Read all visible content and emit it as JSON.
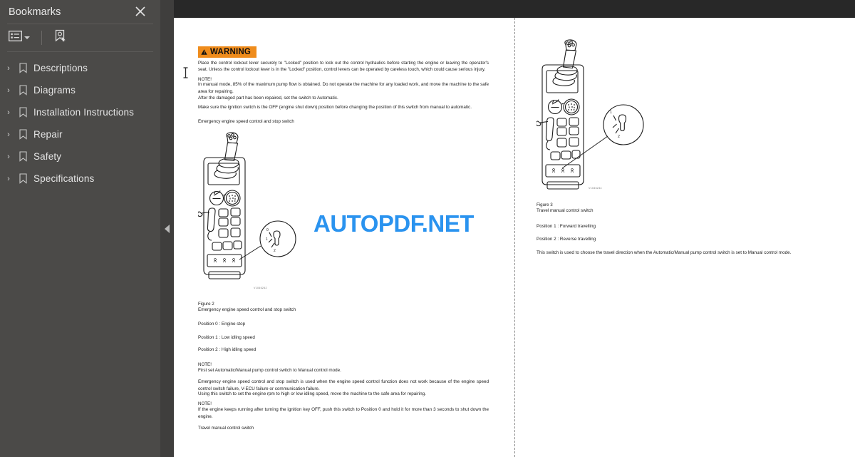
{
  "sidebar": {
    "title": "Bookmarks",
    "close_icon": "close-icon",
    "toolbar": {
      "options_icon": "list-options-icon",
      "options_caret": "chevron-down-icon",
      "new_bookmark_icon": "new-bookmark-icon"
    },
    "items": [
      {
        "label": "Descriptions",
        "expand_arrow": "›",
        "icon": "bookmark-icon"
      },
      {
        "label": "Diagrams",
        "expand_arrow": "›",
        "icon": "bookmark-icon"
      },
      {
        "label": "Installation Instructions",
        "expand_arrow": "›",
        "icon": "bookmark-icon"
      },
      {
        "label": "Repair",
        "expand_arrow": "›",
        "icon": "bookmark-icon"
      },
      {
        "label": "Safety",
        "expand_arrow": "›",
        "icon": "bookmark-icon"
      },
      {
        "label": "Specifications",
        "expand_arrow": "›",
        "icon": "bookmark-icon"
      }
    ]
  },
  "collapse_handle": {
    "icon": "collapse-left-arrow-icon"
  },
  "watermark": {
    "text": "AUTOPDF.NET",
    "color": "#2a93ef"
  },
  "colors": {
    "sidebar_bg": "#4b4a48",
    "topbar_bg": "#282828",
    "warning_orange": "#ef8c1c",
    "page_bg": "#ffffff"
  },
  "document": {
    "left_page": {
      "warning": {
        "label": "WARNING",
        "icon": "warning-triangle-icon",
        "body": "Place the control lockout lever securely to \"Locked\" position to lock out the control hydraulics before starting the engine or leaving the operator's seat. Unless the control lockout lever is in the \"Locked\" position, control levers can be operated by careless touch, which could cause serious injury."
      },
      "note1_label": "NOTE!",
      "note1_body": "In manual mode, 85% of the maximum pump flow is obtained. Do not operate the machine for any loaded work, and move the machine to the safe area for repairing.",
      "para_repaired": "After the damaged part has been repaired, set the switch to Automatic.",
      "para_ignition": "Make sure the ignition switch is the OFF (engine shut down) position before changing the position of this switch from manual to automatic.",
      "heading_emergency": "Emergency engine speed control and stop switch",
      "figure2": {
        "code": "V1046242",
        "title": "Figure 2",
        "caption": "Emergency engine speed control and stop switch",
        "callout_labels": [
          "0",
          "1",
          "2"
        ],
        "illustration": "joystick-control-lever-illustration"
      },
      "positions": [
        {
          "label": "Position 0",
          "value": "Engine stop"
        },
        {
          "label": "Position 1",
          "value": "Low idling speed"
        },
        {
          "label": "Position 2",
          "value": "High idling speed"
        }
      ],
      "note2_label": "NOTE!",
      "note2_body": "First set Automatic/Manual pump control switch to Manual control mode.",
      "para_emergency": "Emergency engine speed control and stop switch is used when the engine speed control function does not work because of the engine speed control switch failure, V-ECU failure or communication failure.",
      "para_using": "Using this switch to set the engine rpm to high or low idling speed, move the machine to the safe area for repairing.",
      "note3_label": "NOTE!",
      "note3_body": "If the engine keeps running after turning the ignition key OFF, push this switch to Position 0 and hold it for more than 3 seconds to shut down the engine.",
      "heading_travel": "Travel manual control switch"
    },
    "right_page": {
      "figure3": {
        "code": "V1046244",
        "title": "Figure 3",
        "caption": "Travel manual control switch",
        "callout_labels": [
          "1",
          "2"
        ],
        "illustration": "joystick-control-lever-illustration"
      },
      "positions": [
        {
          "label": "Position 1",
          "value": "Forward travelling"
        },
        {
          "label": "Position 2",
          "value": "Reverse travelling"
        }
      ],
      "para_switch": "This switch is used to choose the travel direction when the Automatic/Manual pump control switch is set to Manual control mode."
    }
  }
}
